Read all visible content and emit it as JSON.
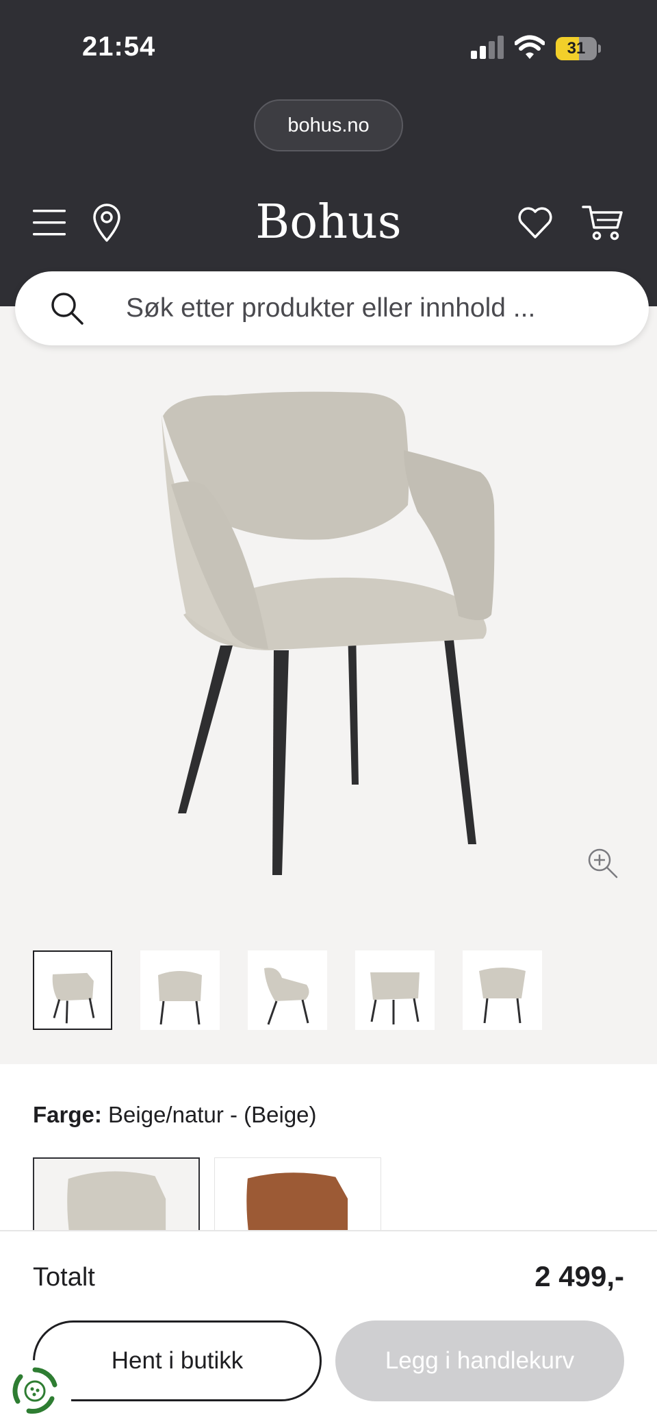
{
  "status_bar": {
    "time": "21:54",
    "battery_level": "31",
    "battery_fraction": 0.31,
    "signal_icon": "cellular-signal-icon",
    "wifi_icon": "wifi-icon",
    "battery_color": "#f2cf2a"
  },
  "browser": {
    "url": "bohus.no"
  },
  "header": {
    "brand": "Bohus",
    "background": "#2f2f34",
    "icons": [
      "menu-icon",
      "location-pin-icon",
      "heart-icon",
      "cart-icon"
    ]
  },
  "search": {
    "placeholder": "Søk etter produkter eller innhold ...",
    "icon": "search-icon"
  },
  "gallery": {
    "background": "#f4f3f2",
    "zoom_icon": "zoom-in-icon",
    "selected_thumbnail": 0,
    "thumbnail_count": 5
  },
  "color": {
    "label": "Farge:",
    "value": "Beige/natur - (Beige)",
    "options_visible": [
      "beige",
      "brown-leather"
    ],
    "selected_option": 0
  },
  "checkout": {
    "total_label": "Totalt",
    "total_price": "2 499,-",
    "pickup_button": "Hent i butikk",
    "add_to_cart_button": "Legg i handlekurv",
    "add_to_cart_color": "#cfcfd1"
  },
  "badge": {
    "icon": "recycle-icon",
    "color": "#2e7d32"
  }
}
